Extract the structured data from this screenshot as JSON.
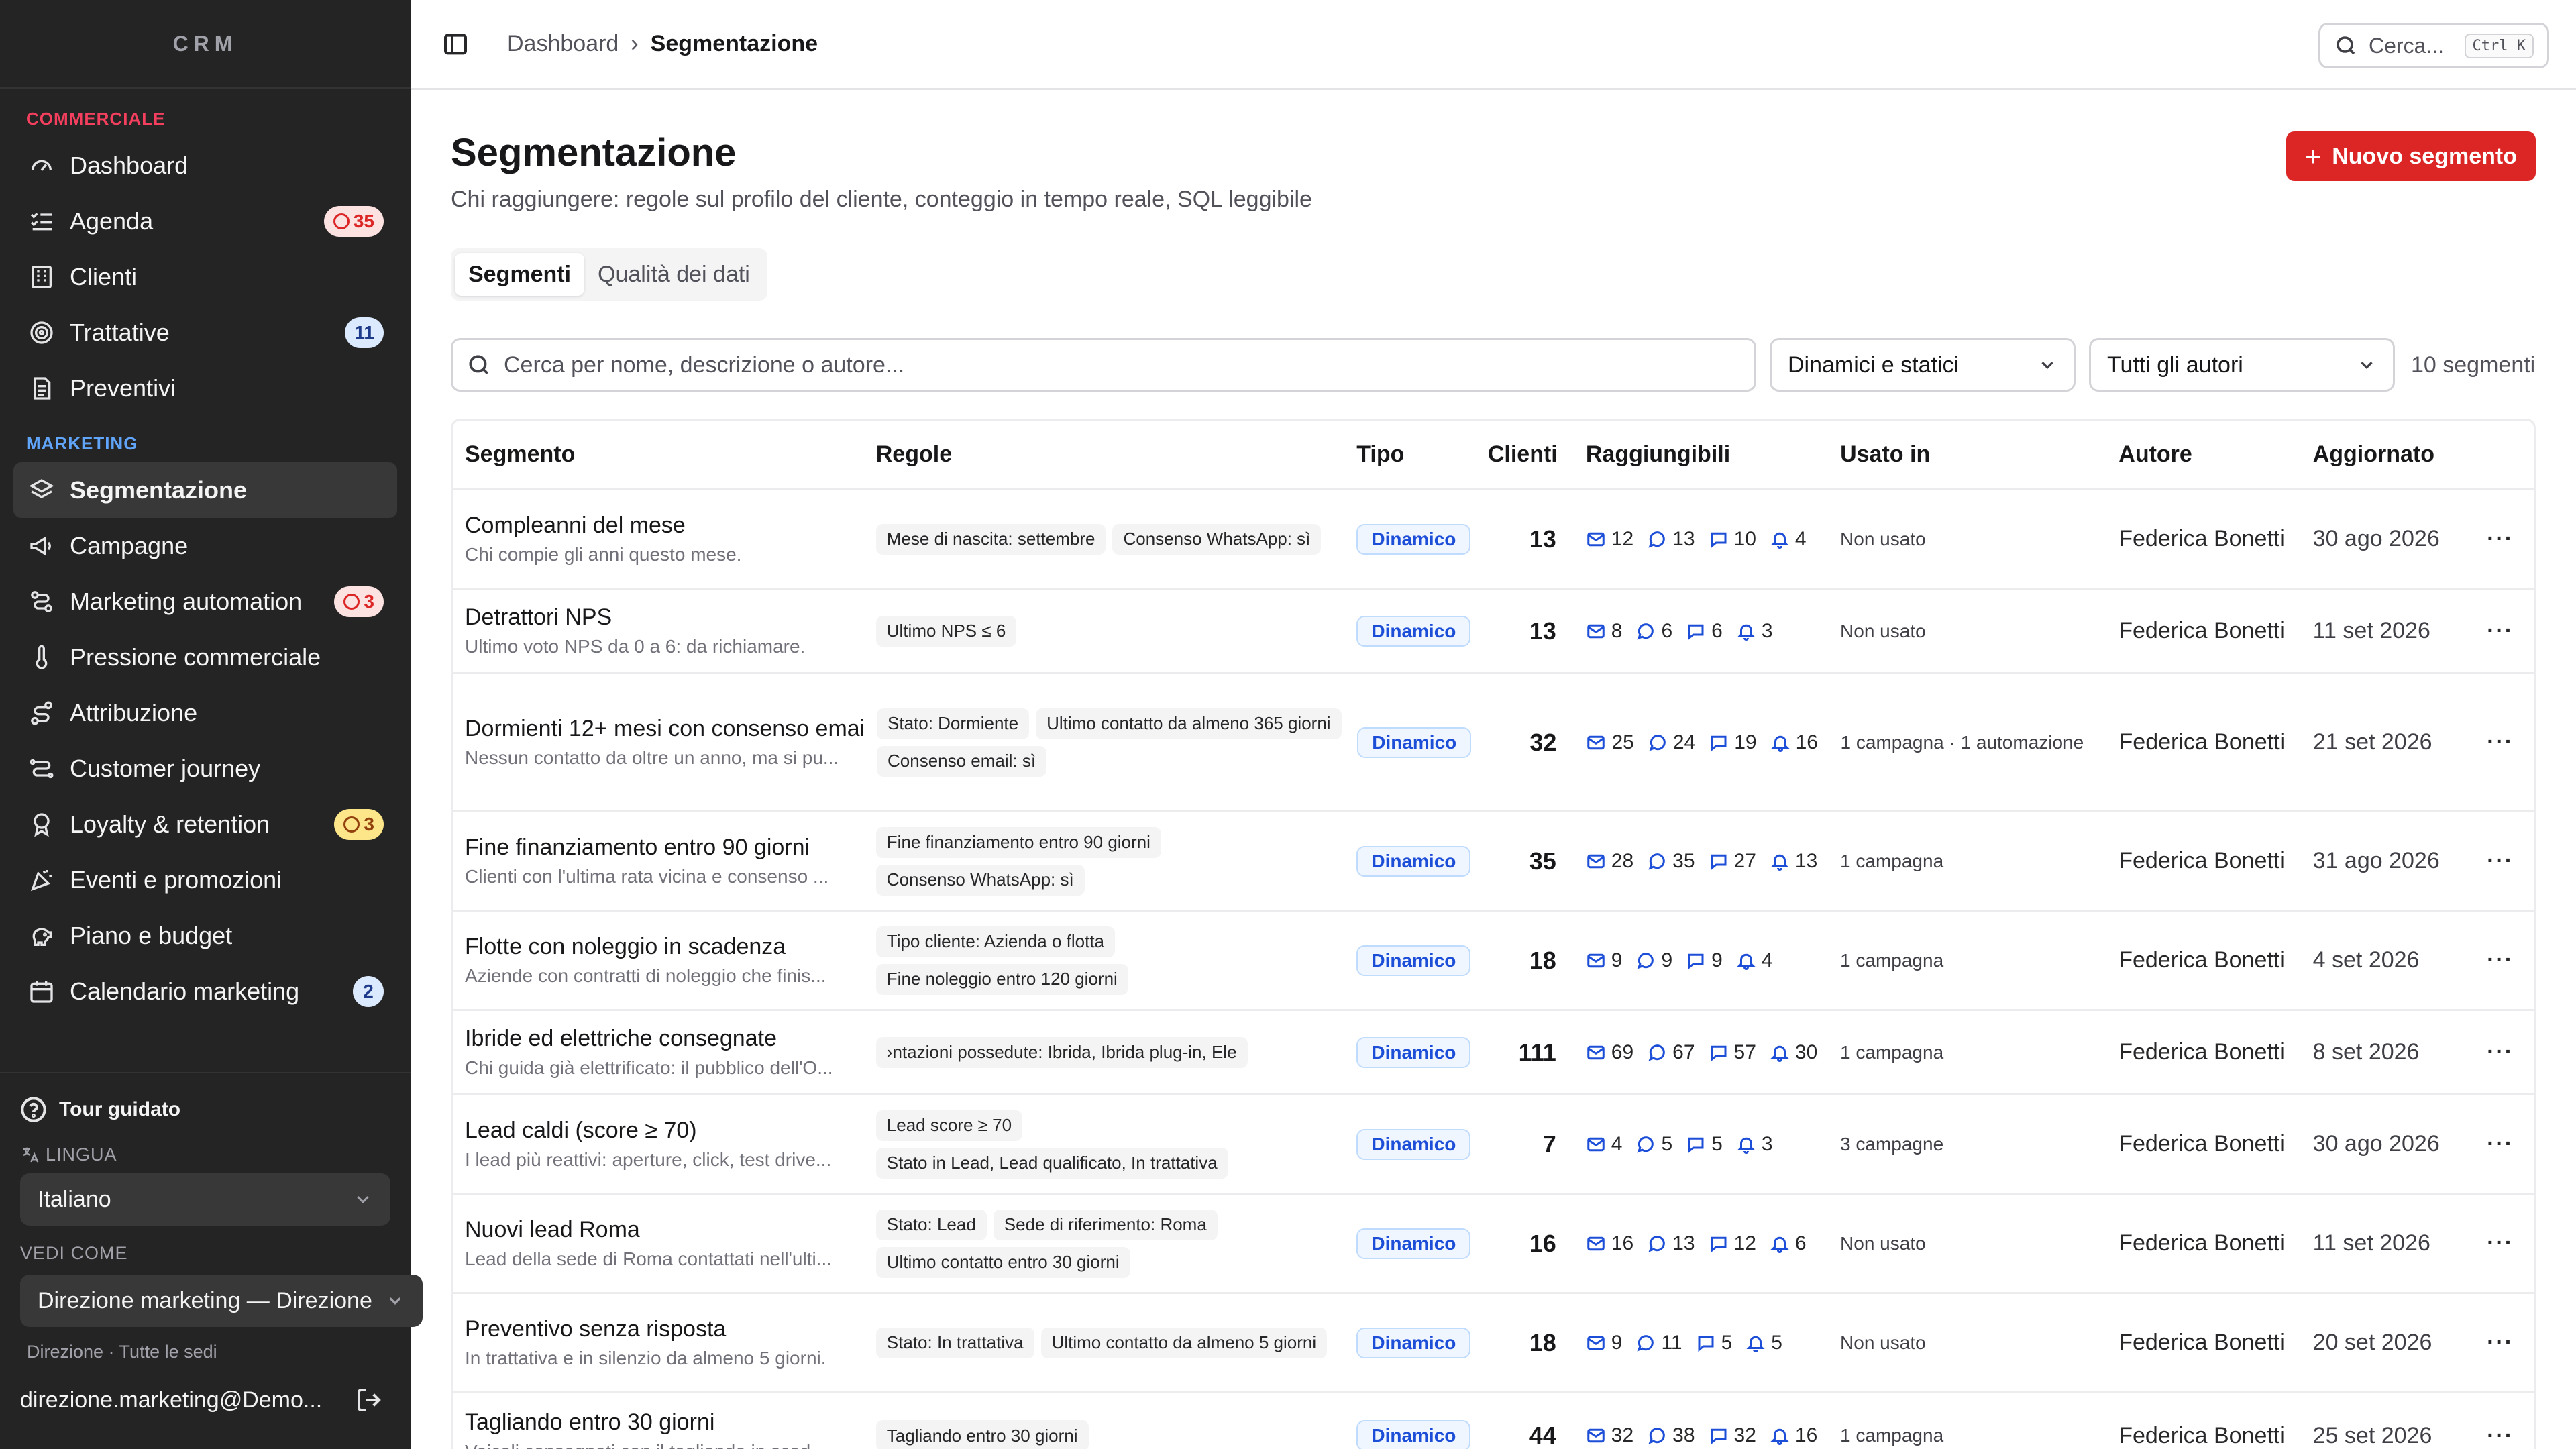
{
  "brand": "CRM",
  "sidebar": {
    "section_commercial": "COMMERCIALE",
    "section_marketing": "MARKETING",
    "commercial_items": [
      {
        "label": "Dashboard",
        "icon": "gauge-icon"
      },
      {
        "label": "Agenda",
        "icon": "list-check-icon",
        "badge": "35"
      },
      {
        "label": "Clienti",
        "icon": "building-icon"
      },
      {
        "label": "Trattative",
        "icon": "target-icon",
        "badge": "11"
      },
      {
        "label": "Preventivi",
        "icon": "document-icon"
      }
    ],
    "marketing_items": [
      {
        "label": "Segmentazione",
        "icon": "layers-icon"
      },
      {
        "label": "Campagne",
        "icon": "megaphone-icon"
      },
      {
        "label": "Marketing automation",
        "icon": "workflow-icon",
        "badge": "3"
      },
      {
        "label": "Pressione commerciale",
        "icon": "thermometer-icon"
      },
      {
        "label": "Attribuzione",
        "icon": "route-icon"
      },
      {
        "label": "Customer journey",
        "icon": "journey-icon"
      },
      {
        "label": "Loyalty & retention",
        "icon": "award-icon",
        "badge": "3"
      },
      {
        "label": "Eventi e promozioni",
        "icon": "party-icon"
      },
      {
        "label": "Piano e budget",
        "icon": "piggy-bank-icon"
      },
      {
        "label": "Calendario marketing",
        "icon": "calendar-icon",
        "badge": "2"
      }
    ],
    "tour": "Tour guidato",
    "lingua_label": "LINGUA",
    "lingua_value": "Italiano",
    "vedi_label": "VEDI COME",
    "vedi_value": "Direzione marketing — Direzione",
    "vedi_note": "Direzione · Tutte le sedi",
    "user_email": "direzione.marketing@Demo..."
  },
  "topbar": {
    "crumb_1": "Dashboard",
    "crumb_2": "Segmentazione",
    "search_placeholder": "Cerca...",
    "search_kbd": "Ctrl K"
  },
  "page": {
    "title": "Segmentazione",
    "subtitle": "Chi raggiungere: regole sul profilo del cliente, conteggio in tempo reale, SQL leggibile",
    "new_button": "Nuovo segmento",
    "tabs": [
      "Segmenti",
      "Qualità dei dati"
    ],
    "search_placeholder": "Cerca per nome, descrizione o autore...",
    "filter_type": "Dinamici e statici",
    "filter_author": "Tutti gli autori",
    "count": "10 segmenti"
  },
  "table": {
    "headers": [
      "Segmento",
      "Regole",
      "Tipo",
      "Clienti",
      "Raggiungibili",
      "Usato in",
      "Autore",
      "Aggiornato"
    ],
    "rows": [
      {
        "name": "Compleanni del mese",
        "desc": "Chi compie gli anni questo mese.",
        "rules": [
          "Mese di nascita: settembre",
          "Consenso WhatsApp: sì"
        ],
        "type": "Dinamico",
        "clients": "13",
        "email": "12",
        "wa": "13",
        "sms": "10",
        "push": "4",
        "used": "Non usato",
        "author": "Federica Bonetti",
        "updated": "30 ago 2026"
      },
      {
        "name": "Detrattori NPS",
        "desc": "Ultimo voto NPS da 0 a 6: da richiamare.",
        "rules": [
          "Ultimo NPS ≤ 6"
        ],
        "type": "Dinamico",
        "clients": "13",
        "email": "8",
        "wa": "6",
        "sms": "6",
        "push": "3",
        "used": "Non usato",
        "author": "Federica Bonetti",
        "updated": "11 set 2026"
      },
      {
        "name": "Dormienti 12+ mesi con consenso email",
        "desc": "Nessun contatto da oltre un anno, ma si pu...",
        "rules": [
          "Stato: Dormiente",
          "Ultimo contatto da almeno 365 giorni",
          "Consenso email: sì"
        ],
        "type": "Dinamico",
        "clients": "32",
        "email": "25",
        "wa": "24",
        "sms": "19",
        "push": "16",
        "used": "1 campagna · 1 automazione",
        "author": "Federica Bonetti",
        "updated": "21 set 2026"
      },
      {
        "name": "Fine finanziamento entro 90 giorni",
        "desc": "Clienti con l'ultima rata vicina e consenso ...",
        "rules": [
          "Fine finanziamento entro 90 giorni",
          "Consenso WhatsApp: sì"
        ],
        "type": "Dinamico",
        "clients": "35",
        "email": "28",
        "wa": "35",
        "sms": "27",
        "push": "13",
        "used": "1 campagna",
        "author": "Federica Bonetti",
        "updated": "31 ago 2026"
      },
      {
        "name": "Flotte con noleggio in scadenza",
        "desc": "Aziende con contratti di noleggio che finis...",
        "rules": [
          "Tipo cliente: Azienda o flotta",
          "Fine noleggio entro 120 giorni"
        ],
        "type": "Dinamico",
        "clients": "18",
        "email": "9",
        "wa": "9",
        "sms": "9",
        "push": "4",
        "used": "1 campagna",
        "author": "Federica Bonetti",
        "updated": "4 set 2026"
      },
      {
        "name": "Ibride ed elettriche consegnate",
        "desc": "Chi guida già elettrificato: il pubblico dell'O...",
        "rules": [
          "›ntazioni possedute: Ibrida, Ibrida plug-in, Ele"
        ],
        "type": "Dinamico",
        "clients": "111",
        "email": "69",
        "wa": "67",
        "sms": "57",
        "push": "30",
        "used": "1 campagna",
        "author": "Federica Bonetti",
        "updated": "8 set 2026"
      },
      {
        "name": "Lead caldi (score ≥ 70)",
        "desc": "I lead più reattivi: aperture, click, test drive...",
        "rules": [
          "Lead score ≥ 70",
          "Stato in Lead, Lead qualificato, In trattativa"
        ],
        "type": "Dinamico",
        "clients": "7",
        "email": "4",
        "wa": "5",
        "sms": "5",
        "push": "3",
        "used": "3 campagne",
        "author": "Federica Bonetti",
        "updated": "30 ago 2026"
      },
      {
        "name": "Nuovi lead Roma",
        "desc": "Lead della sede di Roma contattati nell'ulti...",
        "rules": [
          "Stato: Lead",
          "Sede di riferimento: Roma",
          "Ultimo contatto entro 30 giorni"
        ],
        "type": "Dinamico",
        "clients": "16",
        "email": "16",
        "wa": "13",
        "sms": "12",
        "push": "6",
        "used": "Non usato",
        "author": "Federica Bonetti",
        "updated": "11 set 2026"
      },
      {
        "name": "Preventivo senza risposta",
        "desc": "In trattativa e in silenzio da almeno 5 giorni.",
        "rules": [
          "Stato: In trattativa",
          "Ultimo contatto da almeno 5 giorni"
        ],
        "type": "Dinamico",
        "clients": "18",
        "email": "9",
        "wa": "11",
        "sms": "5",
        "push": "5",
        "used": "Non usato",
        "author": "Federica Bonetti",
        "updated": "20 set 2026"
      },
      {
        "name": "Tagliando entro 30 giorni",
        "desc": "Veicoli consegnati con il tagliando in scad...",
        "rules": [
          "Tagliando entro 30 giorni"
        ],
        "type": "Dinamico",
        "clients": "44",
        "email": "32",
        "wa": "38",
        "sms": "32",
        "push": "16",
        "used": "1 campagna",
        "author": "Federica Bonetti",
        "updated": "25 set 2026"
      }
    ]
  },
  "colors": {
    "sidebar_bg": "#242424",
    "accent_red": "#dc2626",
    "type_pill": "#1d4ed8"
  }
}
